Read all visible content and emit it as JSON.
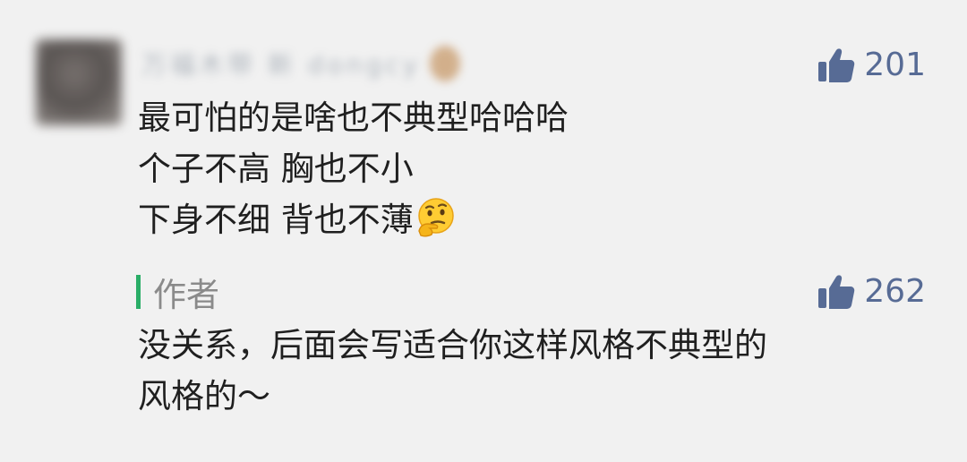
{
  "comment": {
    "username_blurred": "万福木带 新 dongcy",
    "likes": "201",
    "lines": [
      "最可怕的是啥也不典型哈哈哈",
      "个子不高 胸也不小",
      "下身不细 背也不薄"
    ],
    "emoji": "thinking-face"
  },
  "reply": {
    "author_label": "作者",
    "likes": "262",
    "lines": [
      "没关系，后面会写适合你这样风格不典型的",
      "风格的～"
    ]
  },
  "colors": {
    "background": "#f1f1f1",
    "like_blue": "#576b95",
    "author_green": "#2aae67",
    "author_gray": "#8a8a8a",
    "text": "#1f1f1f"
  }
}
